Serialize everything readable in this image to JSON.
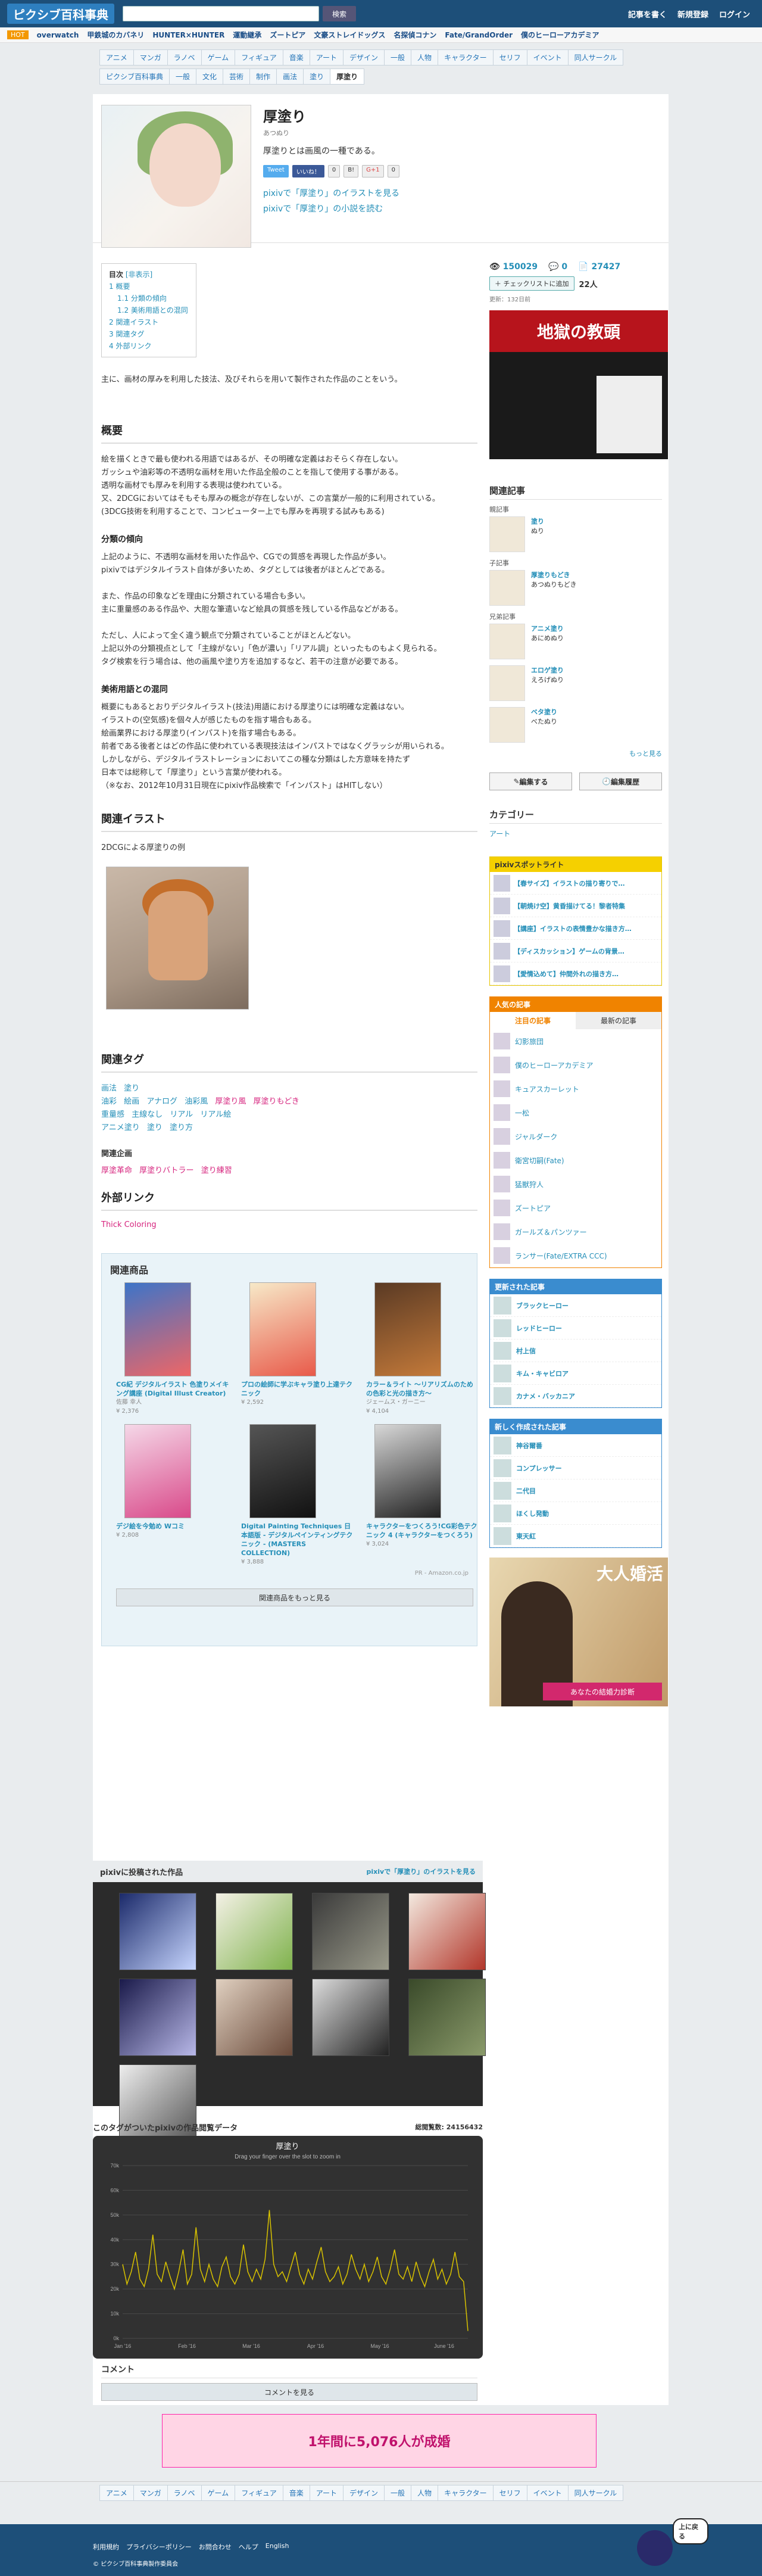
{
  "header": {
    "logo": "ピクシブ百科事典",
    "search_button": "検索",
    "links": [
      "記事を書く",
      "新規登録",
      "ログイン"
    ]
  },
  "hotbar": {
    "label": "HOT",
    "items": [
      "overwatch",
      "甲鉄城のカバネリ",
      "HUNTER×HUNTER",
      "運動継承",
      "ズートピア",
      "文豪ストレイドッグス",
      "名探偵コナン",
      "Fate/GrandOrder",
      "僕のヒーローアカデミア"
    ]
  },
  "catnav": {
    "row1": [
      "アニメ",
      "マンガ",
      "ラノベ",
      "ゲーム",
      "フィギュア",
      "音楽",
      "アート",
      "デザイン",
      "一般",
      "人物",
      "キャラクター",
      "セリフ",
      "イベント",
      "同人サークル"
    ],
    "row2": [
      "ピクシブ百科事典",
      "一般",
      "文化",
      "芸術",
      "制作",
      "画法",
      "塗り",
      "厚塗り"
    ]
  },
  "article": {
    "title": "厚塗り",
    "reading": "あつぬり",
    "lead": "厚塗りとは画風の一種である。",
    "share": {
      "tweet": "Tweet",
      "like": "いいね！",
      "like_count": "0",
      "hatena": "B!",
      "gplus": "G+1",
      "gplus_count": "0"
    },
    "pixiv_illust_link": "pixivで「厚塗り」のイラストを見る",
    "pixiv_novel_link": "pixivで「厚塗り」の小説を読む",
    "toc": {
      "title": "目次",
      "toggle": "[非表示]",
      "items": [
        "1 概要",
        "1.1 分類の傾向",
        "1.2 美術用語との混同",
        "2 関連イラスト",
        "3 関連タグ",
        "4 外部リンク"
      ]
    },
    "intro": "主に、画材の厚みを利用した技法、及びそれらを用いて製作された作品のことをいう。",
    "overview_heading": "概要",
    "overview_paras": [
      "絵を描くときで最も使われる用語ではあるが、その明確な定義はおそらく存在しない。",
      "ガッシュや油彩等の不透明な画材を用いた作品全般のことを指して使用する事がある。",
      "透明な画材でも厚みを利用する表現は使われている。",
      "又、2DCGにおいてはそもそも厚みの概念が存在しないが、この言葉が一般的に利用されている。",
      "(3DCG技術を利用することで、コンピューター上でも厚みを再現する試みもある)"
    ],
    "h_trend": "分類の傾向",
    "trend_paras": [
      "上記のように、不透明な画材を用いた作品や、CGでの質感を再現した作品が多い。",
      "pixivではデジタルイラスト自体が多いため、タグとしては後者がほとんどである。",
      "また、作品の印象などを理由に分類されている場合も多い。",
      "主に重量感のある作品や、大胆な筆遣いなど絵具の質感を残している作品などがある。",
      "ただし、人によって全く違う観点で分類されていることがほとんどない。",
      "上記以外の分類視点として「主線がない」「色が濃い」「リアル調」といったものもよく見られる。",
      "タグ検索を行う場合は、他の画風や塗り方を追加するなど、若干の注意が必要である。"
    ],
    "h_confusion": "美術用語との混同",
    "confusion_paras": [
      "概要にもあるとおりデジタルイラスト(技法)用語における厚塗りには明確な定義はない。",
      "イラストの(空気感)を個々人が感じたものを指す場合もある。",
      "絵画業界における厚塗り(インパスト)を指す場合もある。",
      "前者である後者とはどの作品に使われている表現技法はインパストではなくグラッシが用いられる。",
      "しかしながら、デジタルイラストレーションにおいてこの種な分類はした方意味を持たず",
      "日本では総称して「厚塗り」という言葉が使われる。",
      "（※なお、2012年10月31日現在にpixiv作品検索で「インパスト」はHITしない）"
    ],
    "illust_heading": "関連イラスト",
    "illust_caption": "2DCGによる厚塗りの例",
    "tags_heading": "関連タグ",
    "tag_rows": [
      [
        "画法",
        "塗り"
      ],
      [
        "油彩",
        "絵画",
        "アナログ",
        "油彩風",
        "厚塗り風",
        "厚塗りもどき"
      ],
      [
        "重量感",
        "主線なし",
        "リアル",
        "リアル絵"
      ],
      [
        "アニメ塗り",
        "塗り",
        "塗り方"
      ]
    ],
    "tag_project_heading": "関連企画",
    "tag_project": [
      "厚塗革命",
      "厚塗りバトラー",
      "塗り練習"
    ],
    "ext_heading": "外部リンク",
    "ext_link": "Thick Coloring"
  },
  "products": {
    "heading": "関連商品",
    "items": [
      {
        "title": "CG紀 デジタルイラスト 色塗りメイキング講座 (Digital Illust Creator)",
        "author": "佐藤 幸人",
        "price": "¥ 2,376"
      },
      {
        "title": "プロの絵師に学ぶキャラ塗り上達テクニック",
        "author": "",
        "price": "¥ 2,592"
      },
      {
        "title": "カラー＆ライト ～リアリズムのための色彩と光の描き方～",
        "author": "ジェームス・ガーニー",
        "price": "¥ 4,104"
      },
      {
        "title": "デジ絵を今勉め Wコミ",
        "author": "",
        "price": "¥ 2,808"
      },
      {
        "title": "Digital Painting Techniques 日本語版 - デジタルペインティングテクニック - (MASTERS COLLECTION)",
        "author": "",
        "price": "¥ 3,888"
      },
      {
        "title": "キャラクターをつくろう!CG彩色テクニック 4 (キャラクターをつくろう)",
        "author": "",
        "price": "¥ 3,024"
      }
    ],
    "more_button": "関連商品をもっと見る",
    "credit": "PR - Amazon.co.jp"
  },
  "pixiv": {
    "heading": "pixivに投稿された作品",
    "link": "pixivで「厚塗り」のイラストを見る"
  },
  "chart_section": {
    "heading": "このタグがついたpixivの作品閲覧データ",
    "total": "総閲覧数: 24156432"
  },
  "chart_data": {
    "type": "line",
    "title": "厚塗り",
    "subtitle": "Drag your finger over the slot to zoom in",
    "yticks": [
      "0k",
      "10k",
      "20k",
      "30k",
      "40k",
      "50k",
      "60k",
      "70k"
    ],
    "xticks": [
      "Jan '16",
      "Feb '16",
      "Mar '16",
      "Apr '16",
      "May '16",
      "June '16"
    ],
    "ylim": [
      0,
      70000
    ],
    "series": [
      {
        "values": [
          30000,
          22000,
          27000,
          35000,
          24000,
          21000,
          28000,
          42000,
          26000,
          23000,
          31000,
          25000,
          20000,
          27000,
          36000,
          22000,
          26000,
          45000,
          28000,
          23000,
          30000,
          24000,
          21000,
          29000,
          33000,
          25000,
          22000,
          26000,
          38000,
          27000,
          23000,
          28000,
          24000,
          32000,
          52000,
          30000,
          25000,
          27000,
          23000,
          29000,
          35000,
          26000,
          22000,
          28000,
          24000,
          31000,
          37000,
          27000,
          23000,
          25000,
          29000,
          22000,
          26000,
          34000,
          28000,
          24000,
          30000,
          23000,
          27000,
          33000,
          25000,
          22000,
          28000,
          36000,
          26000,
          24000,
          29000,
          23000,
          31000,
          25000,
          21000,
          27000,
          32000,
          24000,
          28000,
          22000,
          26000,
          35000,
          25000,
          23000,
          3000
        ]
      }
    ]
  },
  "comment": {
    "heading": "コメント",
    "button": "コメントを見る"
  },
  "sidebar": {
    "views": "150029",
    "comments": "0",
    "bookmarks": "27427",
    "checklist_button": "チェックリストに追加",
    "checklist_count": "22人",
    "updated": "更新：132日前",
    "ad_text": "地獄の教頭",
    "related_heading": "関連記事",
    "parent_label": "親記事",
    "parent": {
      "name": "塗り",
      "reading": "ぬり"
    },
    "child_label": "子記事",
    "child": {
      "name": "厚塗りもどき",
      "reading": "あつぬりもどき"
    },
    "sibling_label": "兄弟記事",
    "siblings": [
      {
        "name": "アニメ塗り",
        "reading": "あにめぬり"
      },
      {
        "name": "エロゲ塗り",
        "reading": "えろげぬり"
      },
      {
        "name": "ベタ塗り",
        "reading": "べたぬり"
      }
    ],
    "more": "もっと見る",
    "edit_button": "編集する",
    "history_button": "編集履歴",
    "category_heading": "カテゴリー",
    "category": "アート",
    "spotlight_heading": "pixivスポットライト",
    "spotlight": [
      "【春サイズ】イラストの描り寄りで…",
      "【朝焼け空】黄昏描けてる！黎者特集",
      "【講座】イラストの表情豊かな描き方…",
      "【ディスカッション】ゲームの背景…",
      "【愛情込めて】仲間外れの描き方…"
    ],
    "popular_heading": "人気の記事",
    "popular_tabs": [
      "注目の記事",
      "最新の記事"
    ],
    "popular": [
      "幻影旅団",
      "僕のヒーローアカデミア",
      "キュアスカーレット",
      "一松",
      "ジャルダーク",
      "衛宮切嗣(Fate)",
      "猛獣狩人",
      "ズートピア",
      "ガールズ＆パンツァー",
      "ランサー(Fate/EXTRA CCC)"
    ],
    "updated_heading": "更新された記事",
    "updated_list": [
      "ブラックヒーロー",
      "レッドヒーロー",
      "村上信",
      "キム・キャビロア",
      "カナメ・バッカニア"
    ],
    "new_heading": "新しく作成された記事",
    "new_list": [
      "神谷爾番",
      "コンプレッサー",
      "二代目",
      "ほくし発動",
      "東天紅"
    ],
    "ad2_text": "大人婚活",
    "ad2_banner": "あなたの結婚力診断"
  },
  "bottom_ad": "1年間に5,076人が成婚",
  "footer": {
    "links": [
      "利用規約",
      "プライバシーポリシー",
      "お問合わせ",
      "ヘルプ",
      "English"
    ],
    "copyright": "© ピクシブ百科事典製作委員会",
    "totop": "上に戻る"
  }
}
